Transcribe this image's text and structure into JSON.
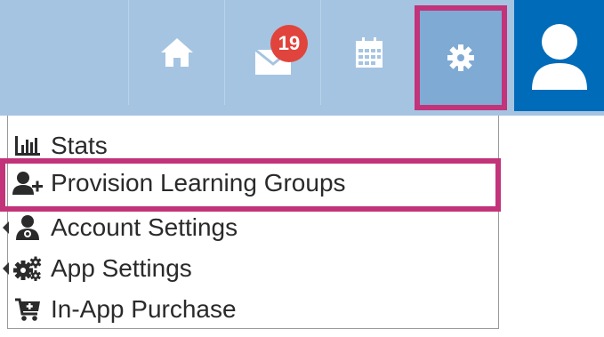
{
  "toolbar": {
    "messages_badge": "19",
    "colors": {
      "bar": "#a5c4e1",
      "settings_active": "#7eaad4",
      "profile": "#006bb8",
      "highlight": "#c2337a",
      "badge": "#e0443c"
    },
    "icons": [
      "home-icon",
      "envelope-icon",
      "calendar-icon",
      "gear-icon",
      "user-icon"
    ]
  },
  "menu": {
    "items": [
      {
        "label": "Stats",
        "icon": "bar-chart-icon"
      },
      {
        "label": "Provision Learning Groups",
        "icon": "add-user-icon"
      },
      {
        "label": "Account Settings",
        "icon": "account-settings-icon"
      },
      {
        "label": "App Settings",
        "icon": "gears-icon"
      },
      {
        "label": "In-App Purchase",
        "icon": "cart-icon"
      }
    ]
  }
}
